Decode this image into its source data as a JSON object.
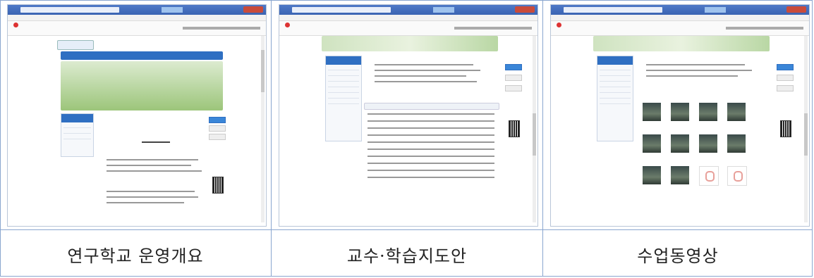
{
  "captions": [
    "연구학교 운영개요",
    "교수·학습지도안",
    "수업동영상"
  ],
  "colors": {
    "border": "#8aa6cf",
    "accent": "#2f6fc2",
    "titlebar": "#3a64b3"
  }
}
